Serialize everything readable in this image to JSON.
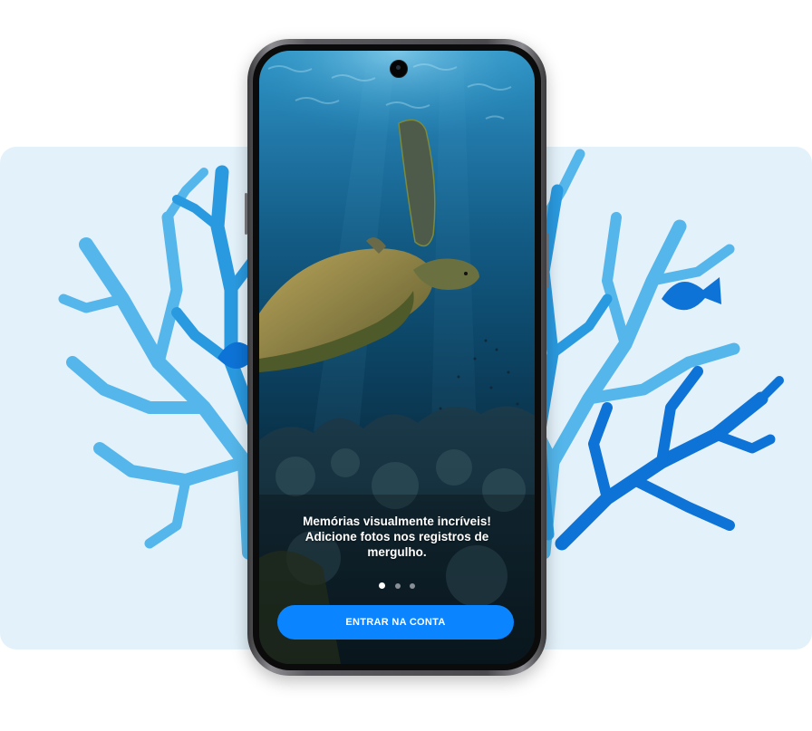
{
  "onboarding": {
    "caption_line1": "Memórias visualmente incríveis!",
    "caption_line2": "Adicione fotos nos registros de",
    "caption_line3": "mergulho.",
    "page_indicator": {
      "current": 1,
      "total": 3
    },
    "login_button_label": "ENTRAR NA CONTA"
  },
  "icons": {
    "coral_left": "coral-illustration",
    "coral_right": "coral-illustration",
    "fish": "fish-silhouette",
    "camera": "front-camera"
  },
  "colors": {
    "backdrop": "#e3f1fa",
    "coral_light": "#54b6ea",
    "coral_mid": "#2a9ae0",
    "coral_dark": "#0d73d6",
    "button": "#0a84ff",
    "button_text": "#ffffff"
  }
}
